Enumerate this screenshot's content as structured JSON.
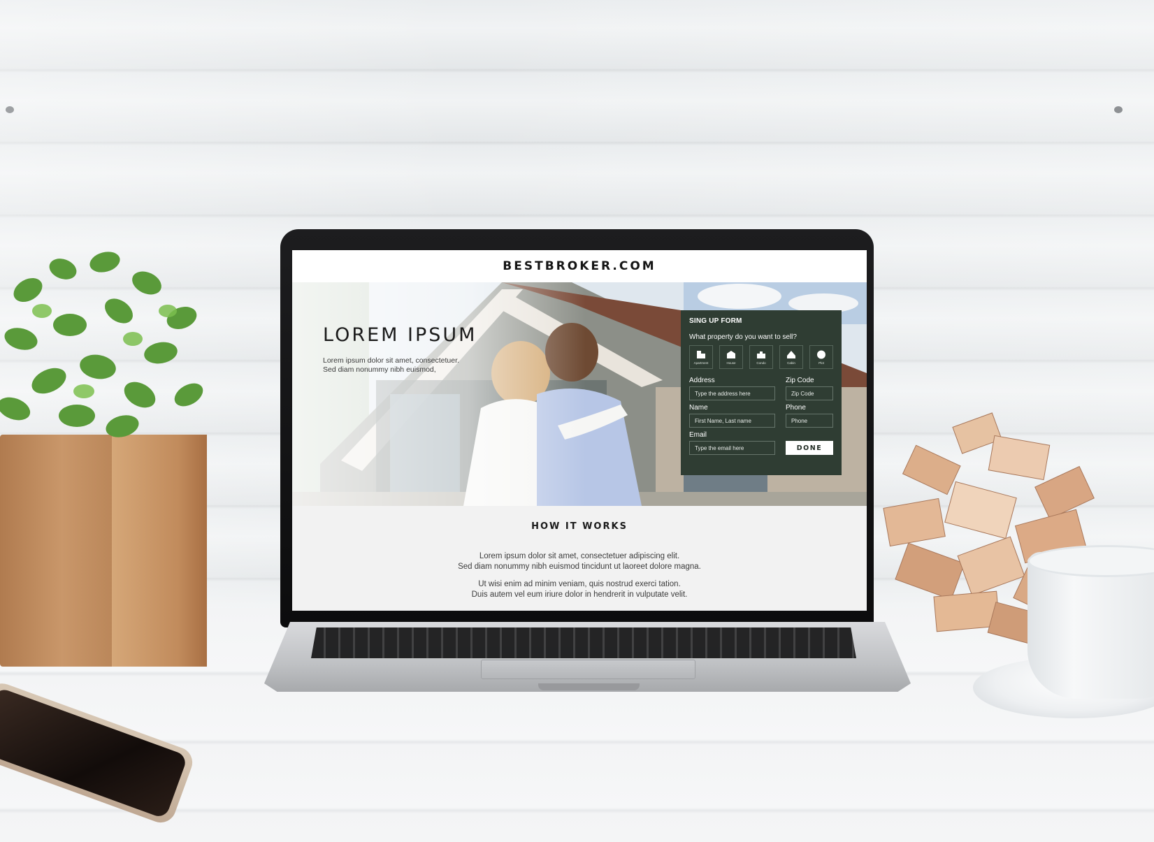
{
  "site": {
    "logo": "BESTBROKER.COM"
  },
  "hero": {
    "title": "LOREM IPSUM",
    "subtitle_line1": "Lorem ipsum dolor sit amet, consectetuer.",
    "subtitle_line2": "Sed diam nonummy nibh euismod,"
  },
  "signup": {
    "title": "SING UP FORM",
    "question": "What property do you want to sell?",
    "property_types": [
      {
        "label": "Apartment",
        "icon": "apartment-icon"
      },
      {
        "label": "House",
        "icon": "house-icon"
      },
      {
        "label": "Condo",
        "icon": "condo-icon"
      },
      {
        "label": "Cabin",
        "icon": "cabin-icon"
      },
      {
        "label": "Plot",
        "icon": "plot-icon"
      }
    ],
    "address": {
      "label": "Address",
      "placeholder": "Type the address here"
    },
    "zip": {
      "label": "Zip Code",
      "placeholder": "Zip Code"
    },
    "name": {
      "label": "Name",
      "placeholder": "First Name, Last name"
    },
    "phone": {
      "label": "Phone",
      "placeholder": "Phone"
    },
    "email": {
      "label": "Email",
      "placeholder": "Type the email here"
    },
    "done_label": "DONE"
  },
  "how_it_works": {
    "title": "HOW IT WORKS",
    "p1_line1": "Lorem ipsum dolor sit amet, consectetuer adipiscing elit.",
    "p1_line2": "Sed diam nonummy nibh euismod tincidunt ut laoreet dolore magna.",
    "p2_line1": "Ut wisi enim ad minim veniam, quis nostrud exerci tation.",
    "p2_line2": "Duis autem vel eum iriure dolor in hendrerit in vulputate velit."
  },
  "colors": {
    "form_background": "#2f3d33",
    "laptop_bezel": "#111111",
    "page_background": "#f2f2f2"
  }
}
